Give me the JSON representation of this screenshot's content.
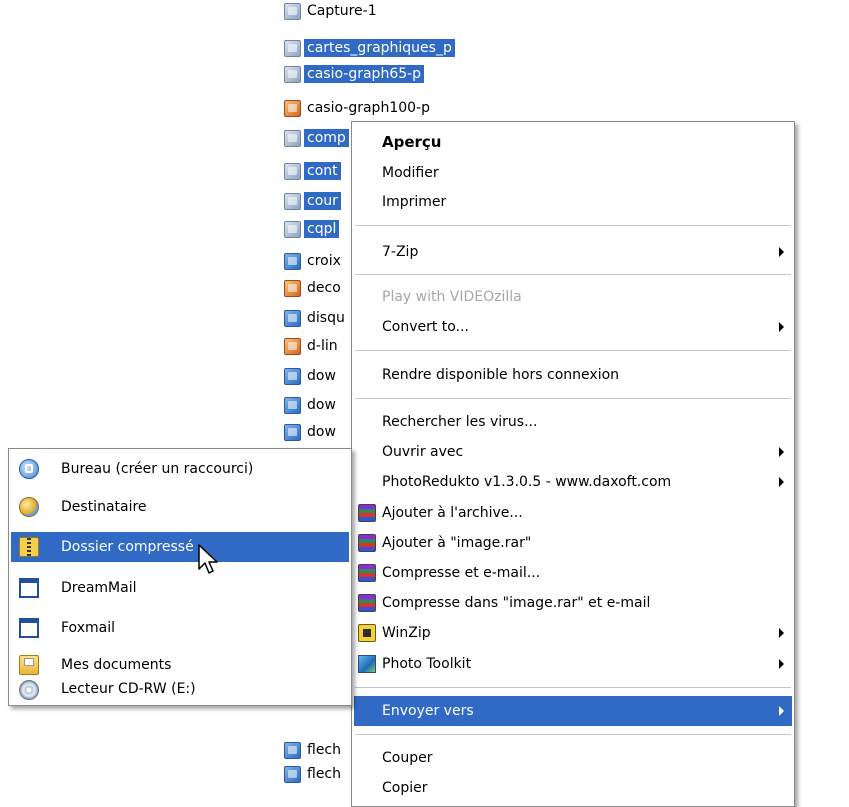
{
  "files": [
    {
      "name": "Capture-1",
      "selected": false,
      "icon": "image-file-icon",
      "color": "grey"
    },
    {
      "name": "cartes_graphiques_p",
      "selected": true,
      "icon": "image-file-icon",
      "color": "grey"
    },
    {
      "name": "casio-graph65-p",
      "selected": true,
      "icon": "image-file-icon",
      "color": "grey"
    },
    {
      "name": "casio-graph100-p",
      "selected": false,
      "icon": "image-file-icon",
      "color": "orange"
    },
    {
      "name": "comp",
      "selected": true,
      "icon": "image-file-icon",
      "color": "grey"
    },
    {
      "name": "cont",
      "selected": true,
      "icon": "image-file-icon",
      "color": "grey"
    },
    {
      "name": "cour",
      "selected": true,
      "icon": "image-file-icon",
      "color": "grey"
    },
    {
      "name": "cqpl",
      "selected": true,
      "icon": "image-file-icon",
      "color": "grey"
    },
    {
      "name": "croix",
      "selected": false,
      "icon": "image-file-icon",
      "color": "blue"
    },
    {
      "name": "deco",
      "selected": false,
      "icon": "image-file-icon",
      "color": "orange"
    },
    {
      "name": "disqu",
      "selected": false,
      "icon": "image-file-icon",
      "color": "blue"
    },
    {
      "name": "d-lin",
      "selected": false,
      "icon": "image-file-icon",
      "color": "orange"
    },
    {
      "name": "dow",
      "selected": false,
      "icon": "image-file-icon",
      "color": "blue"
    },
    {
      "name": "dow",
      "selected": false,
      "icon": "image-file-icon",
      "color": "blue"
    },
    {
      "name": "dow",
      "selected": false,
      "icon": "image-file-icon",
      "color": "blue"
    },
    {
      "name": "flech",
      "selected": false,
      "icon": "image-file-icon",
      "color": "blue"
    },
    {
      "name": "flech",
      "selected": false,
      "icon": "image-file-icon",
      "color": "blue"
    }
  ],
  "context_menu": {
    "items": [
      {
        "label": "Aperçu",
        "bold": true
      },
      {
        "label": "Modifier"
      },
      {
        "label": "Imprimer"
      },
      {
        "label": "7-Zip",
        "submenu": true
      },
      {
        "label": "Play with VIDEOzilla",
        "disabled": true
      },
      {
        "label": "Convert to...",
        "submenu": true
      },
      {
        "label": "Rendre disponible hors connexion"
      },
      {
        "label": "Rechercher les virus..."
      },
      {
        "label": "Ouvrir avec",
        "submenu": true
      },
      {
        "label": "PhotoRedukto v1.3.0.5 - www.daxoft.com",
        "submenu": true
      },
      {
        "label": "Ajouter à l'archive...",
        "icon": "winrar-icon"
      },
      {
        "label": "Ajouter à \"image.rar\"",
        "icon": "winrar-icon"
      },
      {
        "label": "Compresse et e-mail...",
        "icon": "winrar-icon"
      },
      {
        "label": "Compresse dans \"image.rar\" et e-mail",
        "icon": "winrar-icon"
      },
      {
        "label": "WinZip",
        "icon": "winzip-icon",
        "submenu": true
      },
      {
        "label": "Photo Toolkit",
        "icon": "photo-toolkit-icon",
        "submenu": true
      },
      {
        "label": "Envoyer vers",
        "submenu": true,
        "highlighted": true
      },
      {
        "label": "Couper"
      },
      {
        "label": "Copier"
      }
    ]
  },
  "send_to_menu": {
    "items": [
      {
        "label": "Bureau (créer un raccourci)",
        "icon": "desktop-shortcut-icon"
      },
      {
        "label": "Destinataire",
        "icon": "mail-recipient-icon"
      },
      {
        "label": "Dossier compressé",
        "icon": "zip-folder-icon",
        "highlighted": true
      },
      {
        "label": "DreamMail",
        "icon": "application-window-icon"
      },
      {
        "label": "Foxmail",
        "icon": "application-window-icon"
      },
      {
        "label": "Mes documents",
        "icon": "my-documents-icon"
      },
      {
        "label": "Lecteur CD-RW (E:)",
        "icon": "cd-drive-icon"
      }
    ]
  },
  "colors": {
    "selection": "#316ac5",
    "disabled_text": "#a7a7a7",
    "menu_border": "#8a8a8a"
  }
}
